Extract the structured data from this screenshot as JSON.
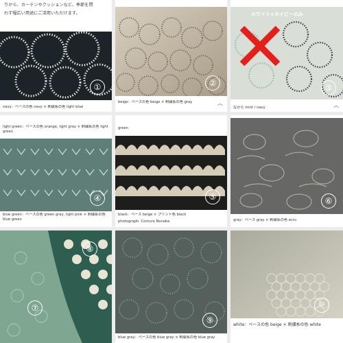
{
  "intro": {
    "line1": "",
    "line2": "りから、カーテンやクッションなど、季節を問",
    "line3": "わず幅広い用途にご活用いただけます。"
  },
  "tiles": [
    {
      "num": "①",
      "caption": "navy：ベースの色 navy × 刺繍糸の色 light blue"
    },
    {
      "num": "②",
      "caption": "beige：ベースの色 beige × 刺繍糸の色 gray"
    },
    {
      "num": "③",
      "caption": "左から mint / navy",
      "banner": "ホワイト×ネイビーのみ"
    },
    {
      "num": "④",
      "caption_top": "light green：ベースの色 orange, light gray × 刺繍糸の色 light green",
      "caption": "blue green：ベースの色 green gray, light pink × 刺繍糸の色 blue green"
    },
    {
      "num": "⑤",
      "caption_top": "green",
      "caption": "black：ベース beige × プリント色 black",
      "caption2": "photograph: Comuro Nonoka"
    },
    {
      "num": "⑥",
      "caption": "gray：ベース gray × 刺繍糸の色 ecru"
    },
    {
      "num": "⑦"
    },
    {
      "num": "⑧"
    },
    {
      "num": "⑨",
      "caption": "blue gray：ベースの色 blue gray × 刺繍糸の色 blue gray"
    },
    {
      "num": "⑩",
      "caption": "white：ベースの色 beige × 刺繍糸の色 white"
    }
  ],
  "colors": {
    "x_mark": "#e3201b",
    "navy": "#1c2329",
    "beige": "#c9bfae"
  },
  "icons": {
    "chevron": "chevron-up-icon"
  }
}
